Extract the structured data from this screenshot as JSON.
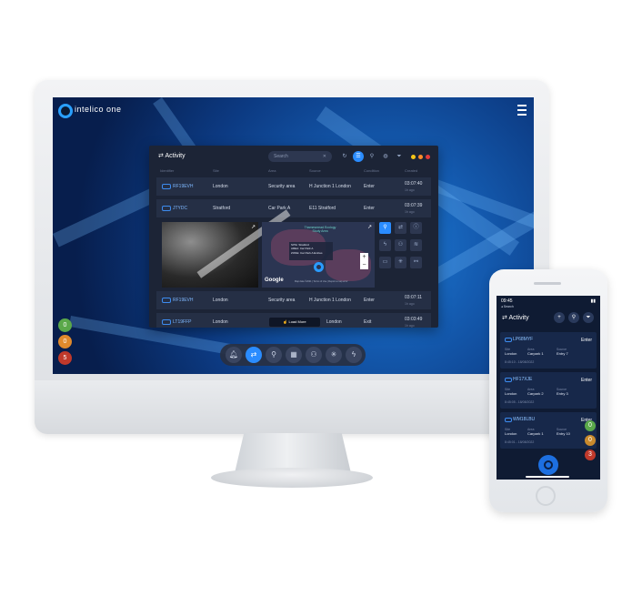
{
  "app": {
    "name": "intelico one"
  },
  "desktop": {
    "panel_title": "Activity",
    "search_placeholder": "Search",
    "columns": [
      "Identifier",
      "Site",
      "Area",
      "Source",
      "Condition",
      "Created"
    ],
    "rows": [
      {
        "plate": "RF19EVH",
        "site": "London",
        "area": "Security area",
        "source": "H Junction 1 London",
        "condition": "Enter",
        "time": "03:07:40",
        "ago": "1h ago"
      },
      {
        "plate": "JTYDC",
        "site": "Stratford",
        "area": "Car Park A",
        "source": "E11 Stratford",
        "condition": "Enter",
        "time": "03:07:39",
        "ago": "1h ago"
      },
      {
        "plate": "RF19EVH",
        "site": "London",
        "area": "Security area",
        "source": "H Junction 1 London",
        "condition": "Enter",
        "time": "03:07:11",
        "ago": "1h ago"
      },
      {
        "plate": "LT19FFP",
        "site": "London",
        "area": "",
        "source": "London",
        "condition": "Exit",
        "time": "03:03:49",
        "ago": "1h ago"
      }
    ],
    "map": {
      "label": "Thamesmead Ecology Study Area",
      "info_lines": [
        "SITE: Stratford",
        "AREA: Car Park A",
        "ZONE: Car Park A Entries"
      ],
      "provider": "Google",
      "credit": "Map data ©2021 | Terms of Use | Report a map error"
    },
    "load_more": "Load More",
    "status_pills": [
      {
        "value": "0",
        "color": "#5aa84a"
      },
      {
        "value": "0",
        "color": "#e08a2c"
      },
      {
        "value": "5",
        "color": "#c0392b"
      }
    ],
    "window_dots": [
      "#f5c518",
      "#ff8c2a",
      "#e23b3b"
    ],
    "dock_icons": [
      "bell-icon",
      "swap-icon",
      "search-icon",
      "grid-icon",
      "users-icon",
      "asterisk-icon",
      "plug-icon"
    ]
  },
  "mobile": {
    "time": "09:45",
    "back_label": "Search",
    "title": "Activity",
    "cards": [
      {
        "plate": "LP68MYF",
        "condition": "Enter",
        "site": "London",
        "area": "Carpark 1",
        "source": "Entry 7",
        "timestamp": "8:45:10 - 18/08/2022"
      },
      {
        "plate": "HF17XJE",
        "condition": "Enter",
        "site": "London",
        "area": "Carpark 2",
        "source": "Entry 3",
        "timestamp": "8:45:05 - 18/08/2022"
      },
      {
        "plate": "WM18LBU",
        "condition": "Enter",
        "site": "London",
        "area": "Carpark 1",
        "source": "Entry 10",
        "timestamp": "8:45:01 - 18/08/2022"
      }
    ],
    "field_labels": {
      "site": "Site",
      "area": "Area",
      "source": "Source"
    },
    "status_pills": [
      {
        "value": "0",
        "color": "#5aa84a"
      },
      {
        "value": "0",
        "color": "#c98a2c"
      },
      {
        "value": "3",
        "color": "#c0392b"
      }
    ]
  },
  "colors": {
    "accent": "#2a8cff",
    "panel": "#1c2436",
    "background_blue": "#0c3a82"
  }
}
